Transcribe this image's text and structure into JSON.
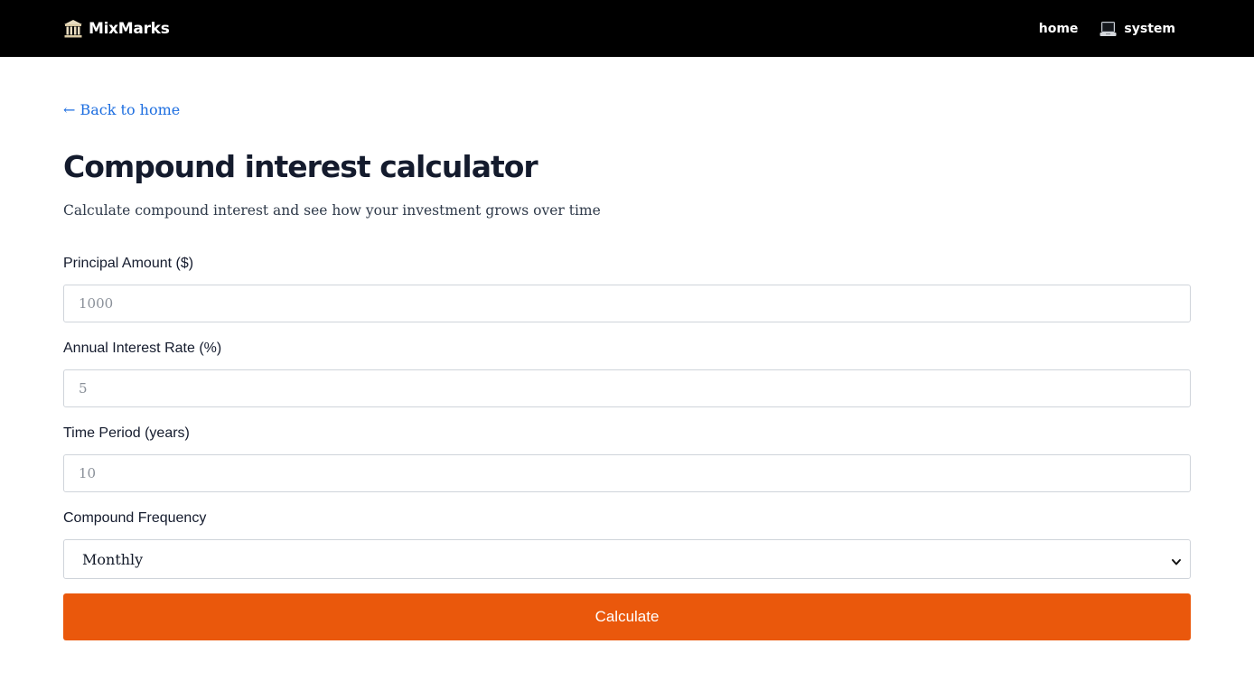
{
  "header": {
    "brand": "MixMarks",
    "brand_icon": "bank-building-icon",
    "nav": {
      "home": "home",
      "system": "system",
      "system_icon": "laptop-icon"
    }
  },
  "main": {
    "back_link": "← Back to home",
    "title": "Compound interest calculator",
    "subtitle": "Calculate compound interest and see how your investment grows over time",
    "fields": [
      {
        "label": "Principal Amount ($)",
        "placeholder": "1000",
        "value": ""
      },
      {
        "label": "Annual Interest Rate (%)",
        "placeholder": "5",
        "value": ""
      },
      {
        "label": "Time Period (years)",
        "placeholder": "10",
        "value": ""
      }
    ],
    "frequency": {
      "label": "Compound Frequency",
      "selected": "Monthly"
    },
    "calculate_label": "Calculate"
  },
  "colors": {
    "header_bg": "#000000",
    "link": "#1d6ee0",
    "button": "#ea580c"
  }
}
